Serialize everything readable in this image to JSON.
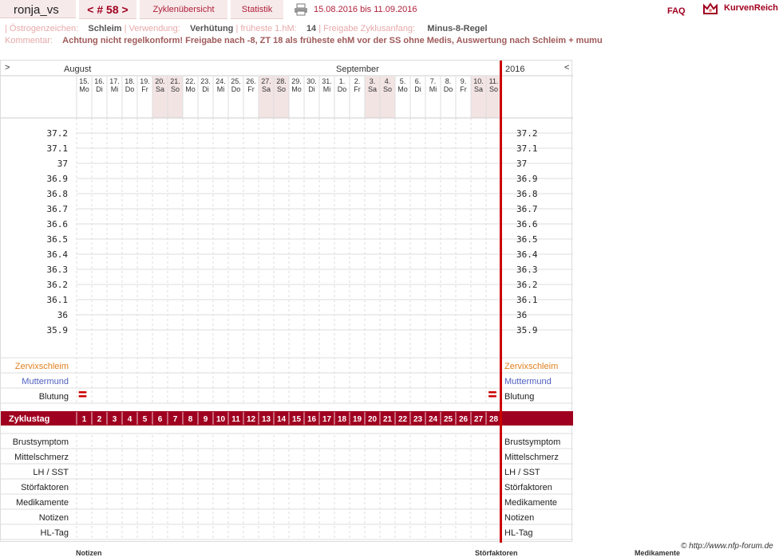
{
  "header": {
    "username": "ronja_vs",
    "cycle_number": "< # 58 >",
    "tab_overview": "Zyklenübersicht",
    "tab_statistics": "Statistik",
    "date_range": "15.08.2016 bis 11.09.2016",
    "faq": "FAQ",
    "logo_text": "KurvenReich"
  },
  "info": {
    "estrogen_label": "Östrogenzeichen:",
    "estrogen_value": "Schleim",
    "usage_label": "Verwendung:",
    "usage_value": "Verhütung",
    "earliest_label": "früheste 1.hM:",
    "earliest_value": "14",
    "release_label": "Freigabe Zyklusanfang:",
    "release_value": "Minus-8-Regel",
    "comment_label": "Kommentar:",
    "comment_value": "Achtung nicht regelkonform! Freigabe nach -8, ZT 18 als früheste ehM vor der SS ohne Medis, Auswertung nach Schleim + mumu"
  },
  "chart_data": {
    "type": "table",
    "nav_prev": ">",
    "nav_next": "<",
    "months": [
      "August",
      "September"
    ],
    "year": "2016",
    "days": [
      {
        "d": "15.",
        "w": "Mo"
      },
      {
        "d": "16.",
        "w": "Di"
      },
      {
        "d": "17.",
        "w": "Mi"
      },
      {
        "d": "18.",
        "w": "Do"
      },
      {
        "d": "19.",
        "w": "Fr"
      },
      {
        "d": "20.",
        "w": "Sa"
      },
      {
        "d": "21.",
        "w": "So"
      },
      {
        "d": "22.",
        "w": "Mo"
      },
      {
        "d": "23.",
        "w": "Di"
      },
      {
        "d": "24.",
        "w": "Mi"
      },
      {
        "d": "25.",
        "w": "Do"
      },
      {
        "d": "26.",
        "w": "Fr"
      },
      {
        "d": "27.",
        "w": "Sa"
      },
      {
        "d": "28.",
        "w": "So"
      },
      {
        "d": "29.",
        "w": "Mo"
      },
      {
        "d": "30.",
        "w": "Di"
      },
      {
        "d": "31.",
        "w": "Mi"
      },
      {
        "d": "1.",
        "w": "Do"
      },
      {
        "d": "2.",
        "w": "Fr"
      },
      {
        "d": "3.",
        "w": "Sa"
      },
      {
        "d": "4.",
        "w": "So"
      },
      {
        "d": "5.",
        "w": "Mo"
      },
      {
        "d": "6.",
        "w": "Di"
      },
      {
        "d": "7.",
        "w": "Mi"
      },
      {
        "d": "8.",
        "w": "Do"
      },
      {
        "d": "9.",
        "w": "Fr"
      },
      {
        "d": "10.",
        "w": "Sa"
      },
      {
        "d": "11.",
        "w": "So"
      }
    ],
    "weekend_indices": [
      5,
      6,
      12,
      13,
      19,
      20,
      26,
      27
    ],
    "temperature_ticks": [
      "37.2",
      "37.1",
      "37",
      "36.9",
      "36.8",
      "36.7",
      "36.6",
      "36.5",
      "36.4",
      "36.3",
      "36.2",
      "36.1",
      "36",
      "35.9"
    ],
    "rows_upper": [
      "Zervixschleim",
      "Muttermund",
      "Blutung"
    ],
    "row_colors": {
      "Zervixschleim": "#e08020",
      "Muttermund": "#5060c0",
      "Blutung": "#222222"
    },
    "bleeding_days": [
      1
    ],
    "cycle_row_label": "Zyklustag",
    "cycle_days": [
      "1",
      "2",
      "3",
      "4",
      "5",
      "6",
      "7",
      "8",
      "9",
      "10",
      "11",
      "12",
      "13",
      "14",
      "15",
      "16",
      "17",
      "18",
      "19",
      "20",
      "21",
      "22",
      "23",
      "24",
      "25",
      "26",
      "27",
      "28"
    ],
    "rows_lower": [
      "Brustsymptom",
      "Mittelschmerz",
      "LH / SST",
      "Störfaktoren",
      "Medikamente",
      "Notizen",
      "HL-Tag"
    ]
  },
  "footer": {
    "copyright": "© http://www.nfp-forum.de",
    "notes": "Notizen",
    "stoerfaktoren": "Störfaktoren",
    "medikamente": "Medikamente"
  },
  "colors": {
    "accent": "#a00020",
    "weekend": "#f3e4e4",
    "grid": "#dddddd"
  }
}
